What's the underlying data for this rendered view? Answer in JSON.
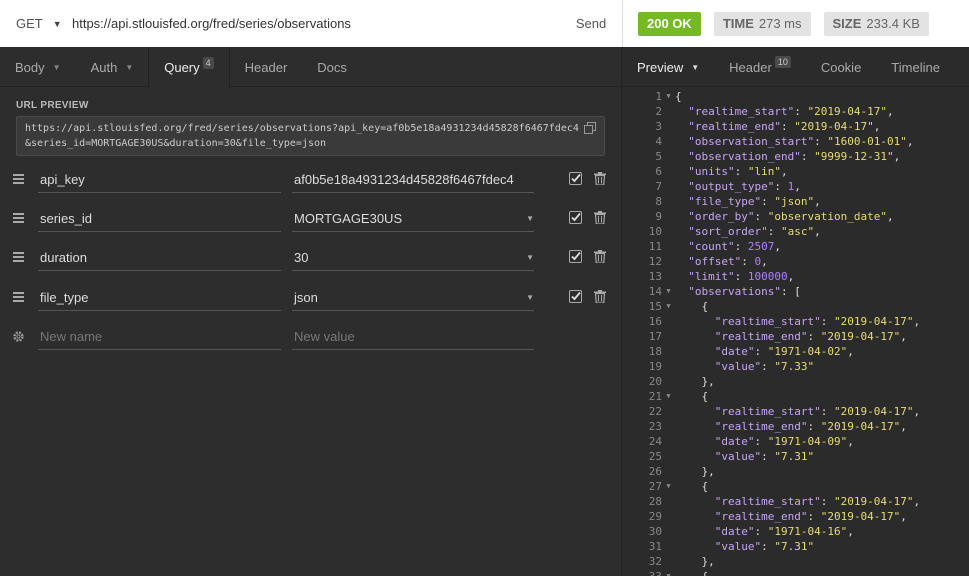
{
  "request": {
    "method": "GET",
    "url": "https://api.stlouisfed.org/fred/series/observations",
    "send_label": "Send"
  },
  "response_status": {
    "status": "200 OK",
    "time_label": "TIME",
    "time_value": "273 ms",
    "size_label": "SIZE",
    "size_value": "233.4 KB"
  },
  "request_tabs": [
    {
      "label": "Body",
      "dropdown": true
    },
    {
      "label": "Auth",
      "dropdown": true
    },
    {
      "label": "Query",
      "badge": "4",
      "active": true
    },
    {
      "label": "Header"
    },
    {
      "label": "Docs"
    }
  ],
  "url_preview": {
    "label": "URL PREVIEW",
    "text": "https://api.stlouisfed.org/fred/series/observations?api_key=af0b5e18a4931234d45828f6467fdec4&series_id=MORTGAGE30US&duration=30&file_type=json"
  },
  "params": [
    {
      "name": "api_key",
      "value": "af0b5e18a4931234d45828f6467fdec4"
    },
    {
      "name": "series_id",
      "value": "MORTGAGE30US"
    },
    {
      "name": "duration",
      "value": "30"
    },
    {
      "name": "file_type",
      "value": "json"
    }
  ],
  "new_param": {
    "name_placeholder": "New name",
    "value_placeholder": "New value"
  },
  "response_tabs": [
    {
      "label": "Preview",
      "dropdown": true,
      "active": true
    },
    {
      "label": "Header",
      "badge": "10"
    },
    {
      "label": "Cookie"
    },
    {
      "label": "Timeline"
    }
  ],
  "code_lines": [
    {
      "n": "1",
      "fold": true,
      "text": "{"
    },
    {
      "n": "2",
      "text": "  \"realtime_start\": \"2019-04-17\","
    },
    {
      "n": "3",
      "text": "  \"realtime_end\": \"2019-04-17\","
    },
    {
      "n": "4",
      "text": "  \"observation_start\": \"1600-01-01\","
    },
    {
      "n": "5",
      "text": "  \"observation_end\": \"9999-12-31\","
    },
    {
      "n": "6",
      "text": "  \"units\": \"lin\","
    },
    {
      "n": "7",
      "text": "  \"output_type\": 1,"
    },
    {
      "n": "8",
      "text": "  \"file_type\": \"json\","
    },
    {
      "n": "9",
      "text": "  \"order_by\": \"observation_date\","
    },
    {
      "n": "10",
      "text": "  \"sort_order\": \"asc\","
    },
    {
      "n": "11",
      "text": "  \"count\": 2507,"
    },
    {
      "n": "12",
      "text": "  \"offset\": 0,"
    },
    {
      "n": "13",
      "text": "  \"limit\": 100000,"
    },
    {
      "n": "14",
      "fold": true,
      "text": "  \"observations\": ["
    },
    {
      "n": "15",
      "fold": true,
      "text": "    {"
    },
    {
      "n": "16",
      "text": "      \"realtime_start\": \"2019-04-17\","
    },
    {
      "n": "17",
      "text": "      \"realtime_end\": \"2019-04-17\","
    },
    {
      "n": "18",
      "text": "      \"date\": \"1971-04-02\","
    },
    {
      "n": "19",
      "text": "      \"value\": \"7.33\""
    },
    {
      "n": "20",
      "text": "    },"
    },
    {
      "n": "21",
      "fold": true,
      "text": "    {"
    },
    {
      "n": "22",
      "text": "      \"realtime_start\": \"2019-04-17\","
    },
    {
      "n": "23",
      "text": "      \"realtime_end\": \"2019-04-17\","
    },
    {
      "n": "24",
      "text": "      \"date\": \"1971-04-09\","
    },
    {
      "n": "25",
      "text": "      \"value\": \"7.31\""
    },
    {
      "n": "26",
      "text": "    },"
    },
    {
      "n": "27",
      "fold": true,
      "text": "    {"
    },
    {
      "n": "28",
      "text": "      \"realtime_start\": \"2019-04-17\","
    },
    {
      "n": "29",
      "text": "      \"realtime_end\": \"2019-04-17\","
    },
    {
      "n": "30",
      "text": "      \"date\": \"1971-04-16\","
    },
    {
      "n": "31",
      "text": "      \"value\": \"7.31\""
    },
    {
      "n": "32",
      "text": "    },"
    },
    {
      "n": "33",
      "fold": true,
      "text": "    {"
    }
  ],
  "colors": {
    "status_ok": "#75ba24",
    "json_key": "#c5a5f5",
    "json_string": "#e6db74",
    "json_number": "#ae81ff"
  }
}
